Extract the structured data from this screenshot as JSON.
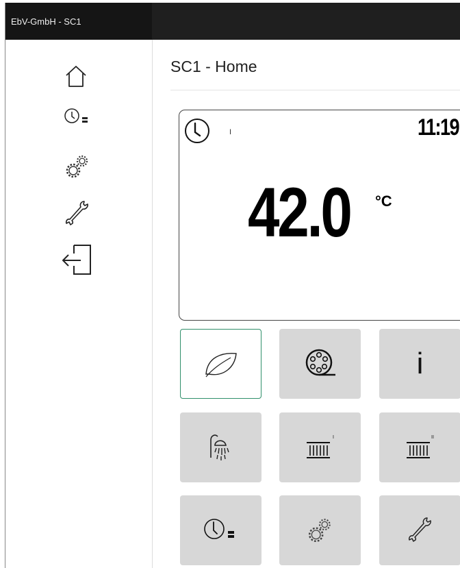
{
  "window": {
    "title": "EbV-GmbH - SC1"
  },
  "sidebar": {
    "items": [
      {
        "icon": "home-icon"
      },
      {
        "icon": "clock-program-icon"
      },
      {
        "icon": "gears-icon"
      },
      {
        "icon": "wrench-icon"
      },
      {
        "icon": "logout-icon"
      }
    ]
  },
  "main": {
    "title": "SC1 - Home",
    "display": {
      "mode": "I",
      "time": "11:19",
      "temperature": "42.0",
      "unit": "°C"
    },
    "tiles": [
      {
        "icon": "leaf-icon",
        "selected": true
      },
      {
        "icon": "film-reel-icon"
      },
      {
        "icon": "info-icon",
        "label": "i"
      },
      {
        "icon": "shower-icon"
      },
      {
        "icon": "radiator-i-icon",
        "label": "I"
      },
      {
        "icon": "radiator-ii-icon",
        "label": "II"
      },
      {
        "icon": "clock-program-icon"
      },
      {
        "icon": "gears-icon"
      },
      {
        "icon": "wrench-icon"
      }
    ]
  },
  "colors": {
    "titlebar": "#1f1f1f",
    "tile": "#d7d7d7",
    "active_border": "#2f8f6a"
  }
}
